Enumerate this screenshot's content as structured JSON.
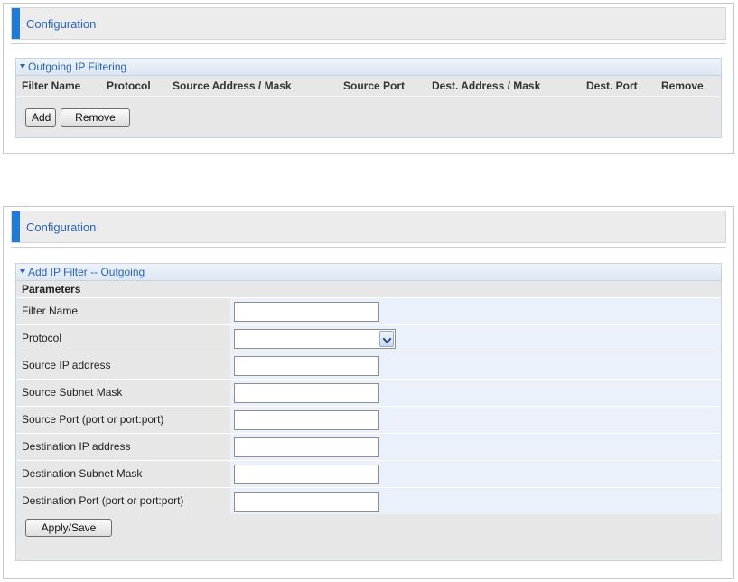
{
  "filter_list": {
    "config_title": "Configuration",
    "section_title": "Outgoing IP Filtering",
    "columns": [
      "Filter Name",
      "Protocol",
      "Source Address / Mask",
      "Source Port",
      "Dest. Address / Mask",
      "Dest. Port",
      "Remove"
    ],
    "add_label": "Add",
    "remove_label": "Remove"
  },
  "add_filter": {
    "config_title": "Configuration",
    "section_title": "Add IP Filter -- Outgoing",
    "parameters_label": "Parameters",
    "fields": [
      {
        "label": "Filter Name",
        "value": ""
      },
      {
        "label": "Protocol",
        "value": ""
      },
      {
        "label": "Source IP address",
        "value": ""
      },
      {
        "label": "Source Subnet Mask",
        "value": ""
      },
      {
        "label": "Source Port (port or port:port)",
        "value": ""
      },
      {
        "label": "Destination IP address",
        "value": ""
      },
      {
        "label": "Destination Subnet Mask",
        "value": ""
      },
      {
        "label": "Destination Port (port or port:port)",
        "value": ""
      }
    ],
    "apply_label": "Apply/Save"
  },
  "colors": {
    "accent": "#1f7bd8",
    "title_text": "#2a63b8",
    "field_bg": "#eaf1fa",
    "label_bg": "#e7e7e7"
  },
  "icons": {
    "section_toggle": "triangle-down-icon",
    "select_arrow": "chevron-down-icon"
  }
}
